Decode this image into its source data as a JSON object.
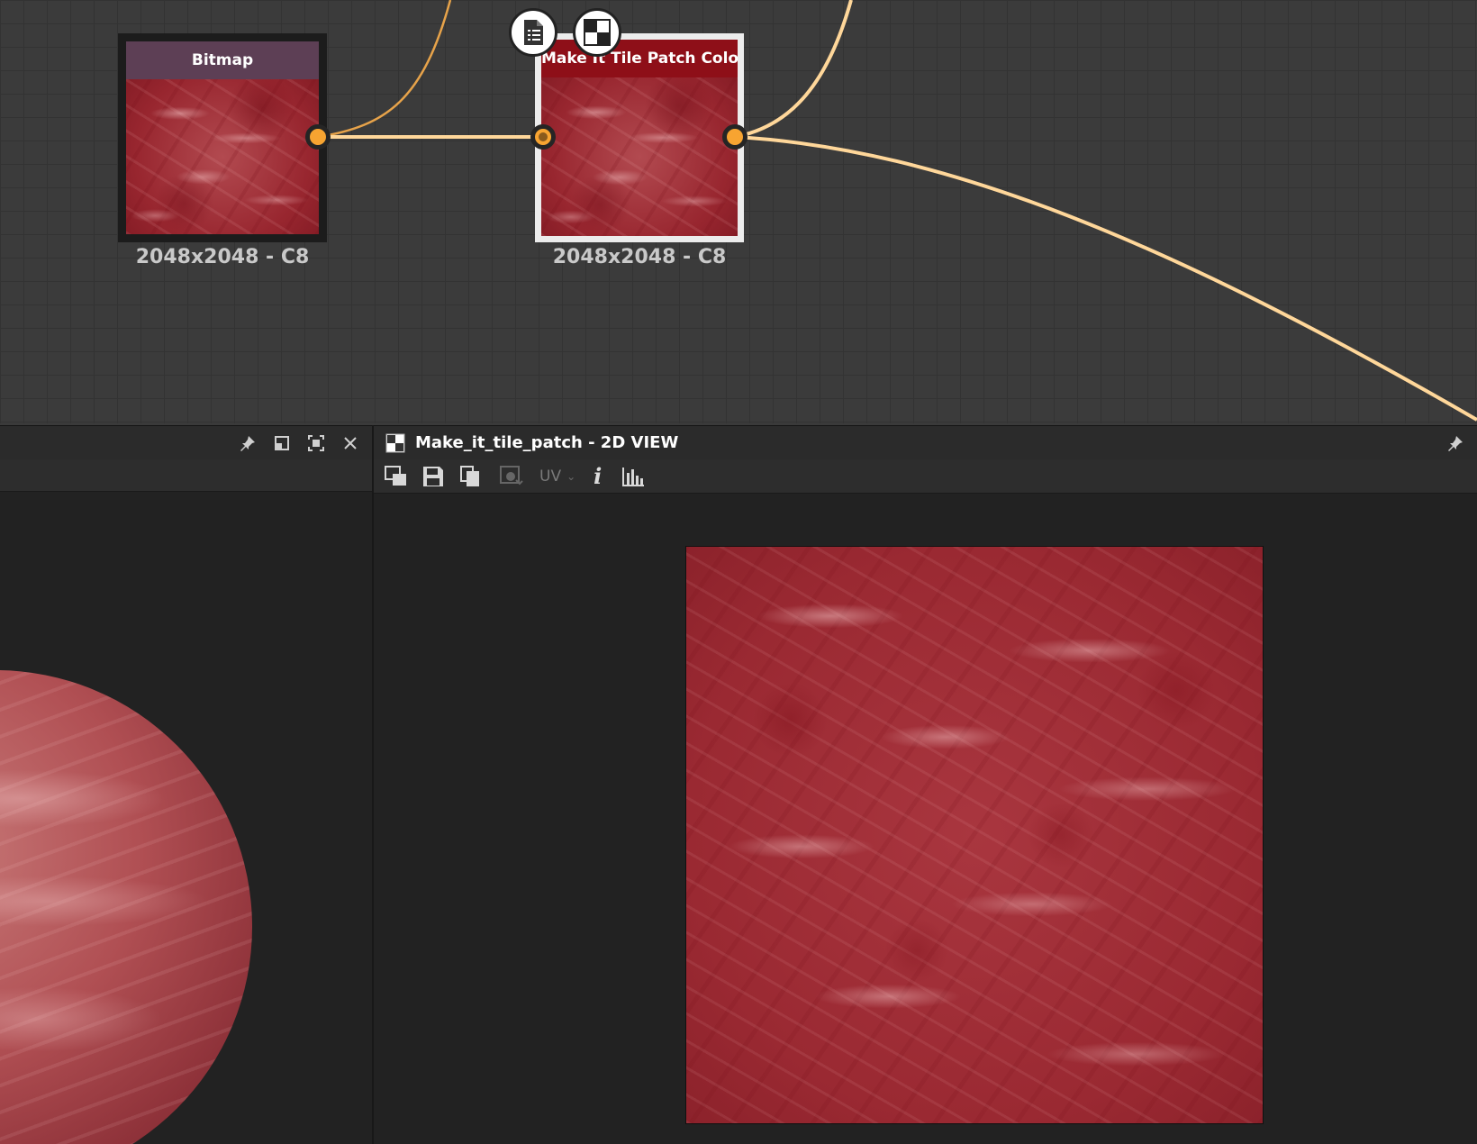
{
  "graph": {
    "nodes": [
      {
        "title": "Bitmap",
        "caption": "2048x2048 - C8",
        "header_color": "#5d3f55"
      },
      {
        "title": "Make It Tile Patch Color",
        "caption": "2048x2048 - C8",
        "header_color": "#8e0f18"
      }
    ],
    "wire_color": "#ffd79a",
    "port_color": "#f7a431"
  },
  "panel_3d": {
    "icons": [
      "pin-icon",
      "float-window-icon",
      "maximize-icon",
      "close-icon"
    ]
  },
  "panel_2d": {
    "title": "Make_it_tile_patch - 2D VIEW",
    "toolbar": {
      "uv_label": "UV",
      "icons": [
        "display-options-icon",
        "save-icon",
        "copy-icon",
        "compare-icon",
        "info-icon",
        "histogram-icon"
      ]
    }
  }
}
